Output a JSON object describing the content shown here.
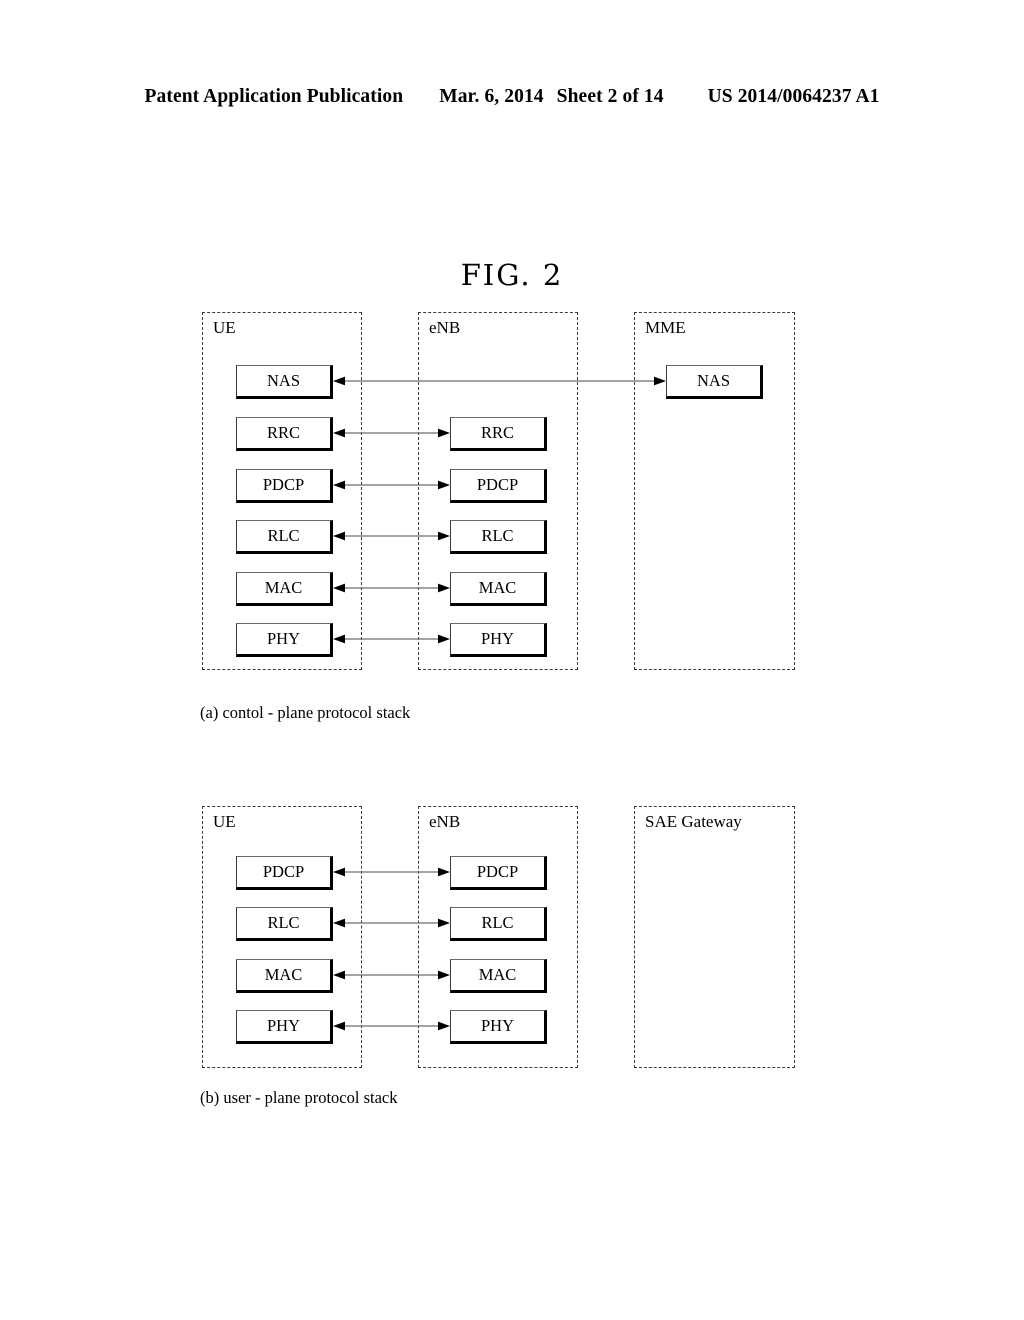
{
  "header": {
    "publication": "Patent Application Publication",
    "date": "Mar. 6, 2014",
    "sheet": "Sheet 2 of 14",
    "patent_number": "US 2014/0064237 A1"
  },
  "figure": {
    "title": "FIG. 2"
  },
  "diagram_a": {
    "caption": "(a) contol - plane protocol stack",
    "columns": [
      {
        "label": "UE",
        "layers": [
          "NAS",
          "RRC",
          "PDCP",
          "RLC",
          "MAC",
          "PHY"
        ]
      },
      {
        "label": "eNB",
        "layers": [
          "RRC",
          "PDCP",
          "RLC",
          "MAC",
          "PHY"
        ]
      },
      {
        "label": "MME",
        "layers": [
          "NAS"
        ]
      }
    ],
    "connections": [
      {
        "from": "UE.NAS",
        "to": "MME.NAS",
        "style": "double-arrow"
      },
      {
        "from": "UE.RRC",
        "to": "eNB.RRC",
        "style": "double-arrow"
      },
      {
        "from": "UE.PDCP",
        "to": "eNB.PDCP",
        "style": "double-arrow"
      },
      {
        "from": "UE.RLC",
        "to": "eNB.RLC",
        "style": "double-arrow"
      },
      {
        "from": "UE.MAC",
        "to": "eNB.MAC",
        "style": "double-arrow"
      },
      {
        "from": "UE.PHY",
        "to": "eNB.PHY",
        "style": "double-arrow"
      }
    ]
  },
  "diagram_b": {
    "caption": "(b) user - plane protocol stack",
    "columns": [
      {
        "label": "UE",
        "layers": [
          "PDCP",
          "RLC",
          "MAC",
          "PHY"
        ]
      },
      {
        "label": "eNB",
        "layers": [
          "PDCP",
          "RLC",
          "MAC",
          "PHY"
        ]
      },
      {
        "label": "SAE Gateway",
        "layers": []
      }
    ],
    "connections": [
      {
        "from": "UE.PDCP",
        "to": "eNB.PDCP",
        "style": "double-arrow"
      },
      {
        "from": "UE.RLC",
        "to": "eNB.RLC",
        "style": "double-arrow"
      },
      {
        "from": "UE.MAC",
        "to": "eNB.MAC",
        "style": "double-arrow"
      },
      {
        "from": "UE.PHY",
        "to": "eNB.PHY",
        "style": "double-arrow"
      }
    ]
  }
}
